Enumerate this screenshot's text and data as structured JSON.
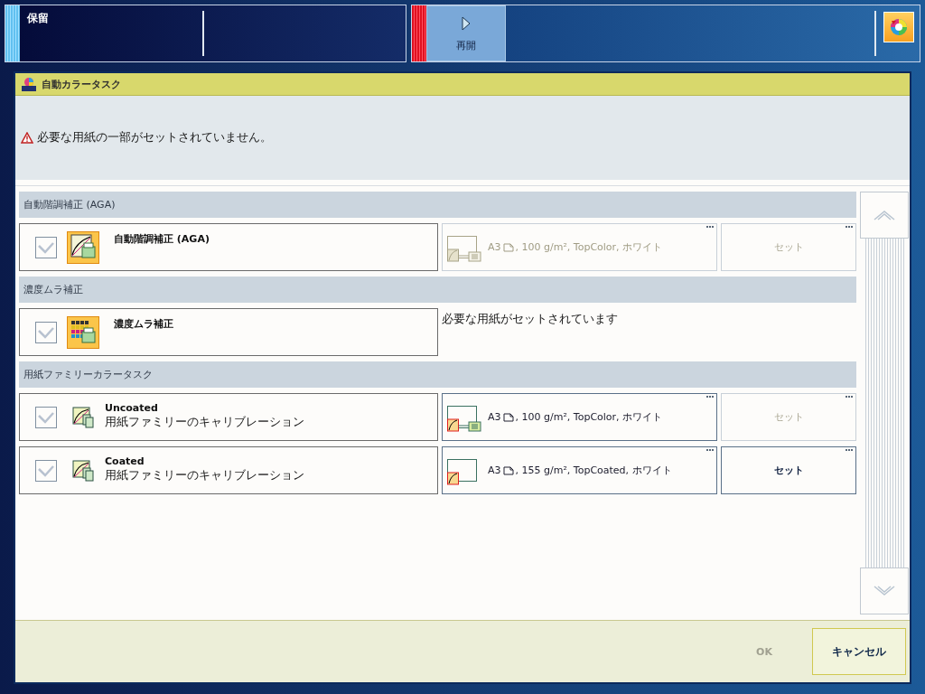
{
  "header": {
    "status_label": "保留",
    "resume_button": "再開"
  },
  "dialog": {
    "title": "自動カラータスク",
    "warning": "必要な用紙の一部がセットされていません。"
  },
  "sections": [
    {
      "title": "自動階調補正 (AGA)",
      "tasks": [
        {
          "kind": "aga",
          "checked": true,
          "title": "自動階調補正 (AGA)",
          "media": {
            "disabled": true,
            "tray": true,
            "size": "A3",
            "details": ", 100 g/m², TopColor, ホワイト"
          },
          "set_button": {
            "label": "セット",
            "disabled": true
          }
        }
      ]
    },
    {
      "title": "濃度ムラ補正",
      "tasks": [
        {
          "kind": "density",
          "checked": true,
          "title": "濃度ムラ補正",
          "status_message": "必要な用紙がセットされています"
        }
      ]
    },
    {
      "title": "用紙ファミリーカラータスク",
      "tasks": [
        {
          "kind": "family",
          "checked": true,
          "title": "Uncoated",
          "subtitle": "用紙ファミリーのキャリブレーション",
          "media": {
            "disabled": false,
            "tray": true,
            "size": "A3",
            "details": ", 100 g/m², TopColor, ホワイト"
          },
          "set_button": {
            "label": "セット",
            "disabled": true
          }
        },
        {
          "kind": "family",
          "checked": true,
          "title": "Coated",
          "subtitle": "用紙ファミリーのキャリブレーション",
          "media": {
            "disabled": false,
            "tray": false,
            "size": "A3",
            "details": ", 155 g/m², TopCoated, ホワイト"
          },
          "set_button": {
            "label": "セット",
            "disabled": false
          }
        }
      ]
    }
  ],
  "footer": {
    "ok_button": {
      "label": "OK",
      "disabled": true
    },
    "cancel_button": "キャンセル"
  }
}
